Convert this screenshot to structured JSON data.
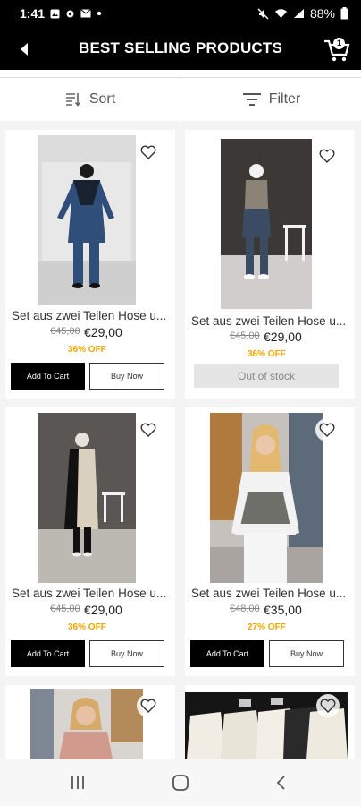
{
  "status_bar": {
    "time": "1:41",
    "left_icons": [
      "image-icon",
      "gear-icon",
      "mail-icon",
      "dot-icon"
    ],
    "right_icons": [
      "mute-icon",
      "wifi-icon",
      "signal-icon"
    ],
    "battery": "88%"
  },
  "app_bar": {
    "title": "BEST SELLING PRODUCTS",
    "cart_count": "1"
  },
  "toolbar": {
    "sort_label": "Sort",
    "filter_label": "Filter"
  },
  "products": [
    {
      "name": "Set aus zwei Teilen Hose u...",
      "old_price": "€45,00",
      "price": "€29,00",
      "discount": "36% OFF",
      "add_label": "Add To Cart",
      "buy_label": "Buy Now"
    },
    {
      "name": "Set aus zwei Teilen Hose u...",
      "old_price": "€45,00",
      "price": "€29,00",
      "discount": "36% OFF",
      "stock_label": "Out of stock"
    },
    {
      "name": "Set aus zwei Teilen Hose u...",
      "old_price": "€45,00",
      "price": "€29,00",
      "discount": "36% OFF",
      "add_label": "Add To Cart",
      "buy_label": "Buy Now"
    },
    {
      "name": "Set aus zwei Teilen Hose u...",
      "old_price": "€48,00",
      "price": "€35,00",
      "discount": "27% OFF",
      "add_label": "Add To Cart",
      "buy_label": "Buy Now"
    }
  ],
  "nav_bar": {
    "items": [
      "recents-icon",
      "home-icon",
      "back-icon"
    ]
  }
}
